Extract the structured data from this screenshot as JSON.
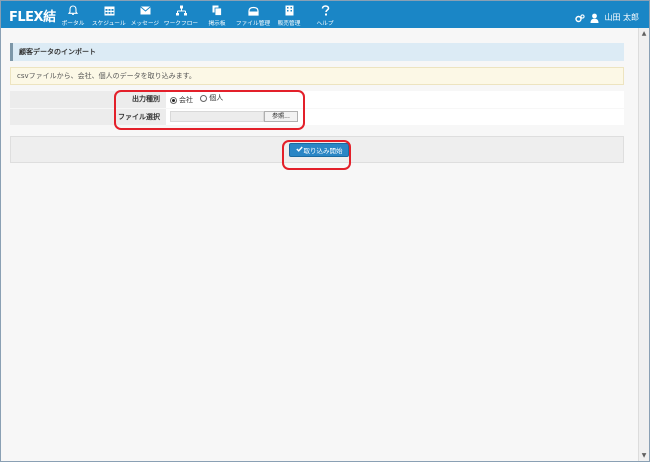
{
  "app": {
    "brand": "FLEX結"
  },
  "nav": [
    {
      "id": "portal",
      "label": "ポータル",
      "icon": "bell-icon"
    },
    {
      "id": "schedule",
      "label": "スケジュール",
      "icon": "calendar-icon"
    },
    {
      "id": "message",
      "label": "メッセージ",
      "icon": "envelope-icon"
    },
    {
      "id": "workflow",
      "label": "ワークフロー",
      "icon": "workflow-icon"
    },
    {
      "id": "board",
      "label": "掲示板",
      "icon": "board-icon"
    },
    {
      "id": "files",
      "label": "ファイル管理",
      "icon": "folder-icon"
    },
    {
      "id": "sales",
      "label": "販売管理",
      "icon": "building-icon"
    },
    {
      "id": "help",
      "label": "ヘルプ",
      "icon": "question-icon"
    }
  ],
  "user": {
    "name": "山田 太郎"
  },
  "panel": {
    "title": "顧客データのインポート"
  },
  "info": {
    "text": "csvファイルから、会社、個人のデータを取り込みます。"
  },
  "form": {
    "output_type_label": "出力種別",
    "options": [
      {
        "label": "会社",
        "checked": true
      },
      {
        "label": "個人",
        "checked": false
      }
    ],
    "file_label": "ファイル選択",
    "browse_label": "参照..."
  },
  "action": {
    "start_label": "取り込み開始"
  },
  "colors": {
    "topbar": "#1a86c6",
    "accent": "#2b86c5",
    "highlight": "#e3202a"
  }
}
